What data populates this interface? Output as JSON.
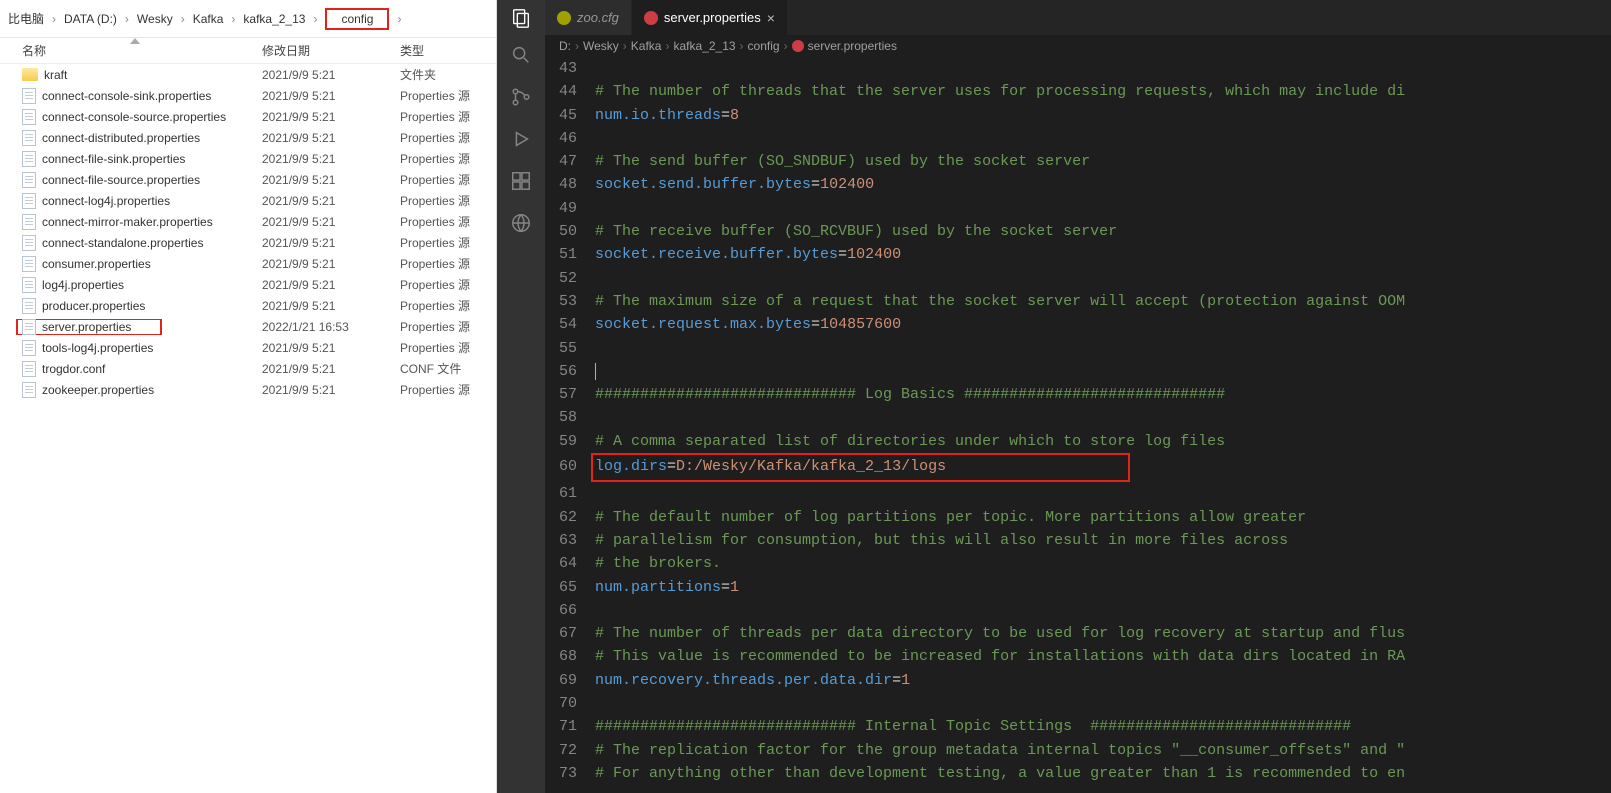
{
  "explorer": {
    "breadcrumb": [
      "比电脑",
      "DATA (D:)",
      "Wesky",
      "Kafka",
      "kafka_2_13"
    ],
    "breadcrumb_highlight": "config",
    "headers": {
      "name": "名称",
      "date": "修改日期",
      "type": "类型"
    },
    "files": [
      {
        "icon": "folder",
        "name": "kraft",
        "date": "2021/9/9 5:21",
        "type": "文件夹",
        "hl": false
      },
      {
        "icon": "file",
        "name": "connect-console-sink.properties",
        "date": "2021/9/9 5:21",
        "type": "Properties 源",
        "hl": false
      },
      {
        "icon": "file",
        "name": "connect-console-source.properties",
        "date": "2021/9/9 5:21",
        "type": "Properties 源",
        "hl": false
      },
      {
        "icon": "file",
        "name": "connect-distributed.properties",
        "date": "2021/9/9 5:21",
        "type": "Properties 源",
        "hl": false
      },
      {
        "icon": "file",
        "name": "connect-file-sink.properties",
        "date": "2021/9/9 5:21",
        "type": "Properties 源",
        "hl": false
      },
      {
        "icon": "file",
        "name": "connect-file-source.properties",
        "date": "2021/9/9 5:21",
        "type": "Properties 源",
        "hl": false
      },
      {
        "icon": "file",
        "name": "connect-log4j.properties",
        "date": "2021/9/9 5:21",
        "type": "Properties 源",
        "hl": false
      },
      {
        "icon": "file",
        "name": "connect-mirror-maker.properties",
        "date": "2021/9/9 5:21",
        "type": "Properties 源",
        "hl": false
      },
      {
        "icon": "file",
        "name": "connect-standalone.properties",
        "date": "2021/9/9 5:21",
        "type": "Properties 源",
        "hl": false
      },
      {
        "icon": "file",
        "name": "consumer.properties",
        "date": "2021/9/9 5:21",
        "type": "Properties 源",
        "hl": false
      },
      {
        "icon": "file",
        "name": "log4j.properties",
        "date": "2021/9/9 5:21",
        "type": "Properties 源",
        "hl": false
      },
      {
        "icon": "file",
        "name": "producer.properties",
        "date": "2021/9/9 5:21",
        "type": "Properties 源",
        "hl": false
      },
      {
        "icon": "file",
        "name": "server.properties",
        "date": "2022/1/21 16:53",
        "type": "Properties 源",
        "hl": true
      },
      {
        "icon": "file",
        "name": "tools-log4j.properties",
        "date": "2021/9/9 5:21",
        "type": "Properties 源",
        "hl": false
      },
      {
        "icon": "file",
        "name": "trogdor.conf",
        "date": "2021/9/9 5:21",
        "type": "CONF 文件",
        "hl": false
      },
      {
        "icon": "file",
        "name": "zookeeper.properties",
        "date": "2021/9/9 5:21",
        "type": "Properties 源",
        "hl": false
      }
    ]
  },
  "vscode": {
    "tabs": [
      {
        "label": "zoo.cfg",
        "active": false,
        "icon": "yellow"
      },
      {
        "label": "server.properties",
        "active": true,
        "icon": "red"
      }
    ],
    "breadcrumb": [
      "D:",
      "Wesky",
      "Kafka",
      "kafka_2_13",
      "config",
      "server.properties"
    ],
    "lines": [
      {
        "n": 43,
        "t": "blank"
      },
      {
        "n": 44,
        "t": "comment",
        "text": "# The number of threads that the server uses for processing requests, which may include di"
      },
      {
        "n": 45,
        "t": "kv",
        "key": "num.io.threads",
        "val": "8"
      },
      {
        "n": 46,
        "t": "blank"
      },
      {
        "n": 47,
        "t": "comment",
        "text": "# The send buffer (SO_SNDBUF) used by the socket server"
      },
      {
        "n": 48,
        "t": "kv",
        "key": "socket.send.buffer.bytes",
        "val": "102400"
      },
      {
        "n": 49,
        "t": "blank"
      },
      {
        "n": 50,
        "t": "comment",
        "text": "# The receive buffer (SO_RCVBUF) used by the socket server"
      },
      {
        "n": 51,
        "t": "kv",
        "key": "socket.receive.buffer.bytes",
        "val": "102400"
      },
      {
        "n": 52,
        "t": "blank"
      },
      {
        "n": 53,
        "t": "comment",
        "text": "# The maximum size of a request that the socket server will accept (protection against OOM"
      },
      {
        "n": 54,
        "t": "kv",
        "key": "socket.request.max.bytes",
        "val": "104857600"
      },
      {
        "n": 55,
        "t": "blank"
      },
      {
        "n": 56,
        "t": "cursor"
      },
      {
        "n": 57,
        "t": "comment",
        "text": "############################# Log Basics #############################"
      },
      {
        "n": 58,
        "t": "blank"
      },
      {
        "n": 59,
        "t": "comment",
        "text": "# A comma separated list of directories under which to store log files"
      },
      {
        "n": 60,
        "t": "kv_hl",
        "key": "log.dirs",
        "val": "D:/Wesky/Kafka/kafka_2_13/logs"
      },
      {
        "n": 61,
        "t": "blank"
      },
      {
        "n": 62,
        "t": "comment",
        "text": "# The default number of log partitions per topic. More partitions allow greater"
      },
      {
        "n": 63,
        "t": "comment",
        "text": "# parallelism for consumption, but this will also result in more files across"
      },
      {
        "n": 64,
        "t": "comment",
        "text": "# the brokers."
      },
      {
        "n": 65,
        "t": "kv",
        "key": "num.partitions",
        "val": "1"
      },
      {
        "n": 66,
        "t": "blank"
      },
      {
        "n": 67,
        "t": "comment",
        "text": "# The number of threads per data directory to be used for log recovery at startup and flus"
      },
      {
        "n": 68,
        "t": "comment",
        "text": "# This value is recommended to be increased for installations with data dirs located in RA"
      },
      {
        "n": 69,
        "t": "kv",
        "key": "num.recovery.threads.per.data.dir",
        "val": "1"
      },
      {
        "n": 70,
        "t": "blank"
      },
      {
        "n": 71,
        "t": "comment",
        "text": "############################# Internal Topic Settings  #############################"
      },
      {
        "n": 72,
        "t": "comment",
        "text": "# The replication factor for the group metadata internal topics \"__consumer_offsets\" and \""
      },
      {
        "n": 73,
        "t": "comment",
        "text": "# For anything other than development testing, a value greater than 1 is recommended to en"
      }
    ]
  }
}
